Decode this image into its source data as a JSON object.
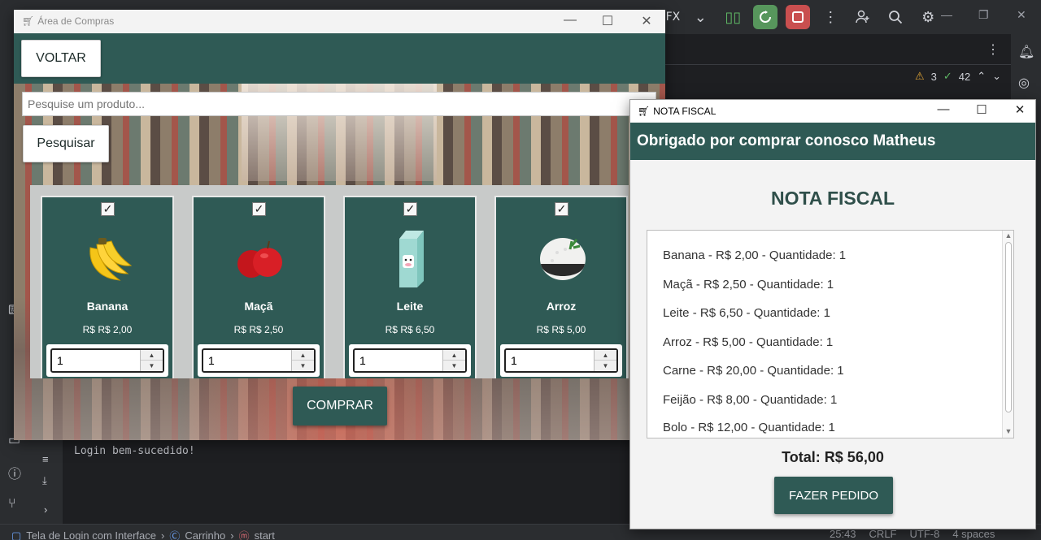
{
  "ide": {
    "run_config_label": "aFX",
    "inspections_warnings": "3",
    "inspections_ok": "42",
    "console_output": "Login bem-sucedido!",
    "status": {
      "crumb_1": "Tela de Login com Interface",
      "crumb_2": "Carrinho",
      "crumb_3": "start",
      "position": "25:43",
      "line_ending": "CRLF",
      "encoding": "UTF-8",
      "indent": "4 spaces"
    }
  },
  "shop_window": {
    "title": "Área de Compras",
    "back_label": "VOLTAR",
    "search": {
      "placeholder": "Pesquise um produto...",
      "button": "Pesquisar"
    },
    "products": [
      {
        "name": "Banana",
        "price": "R$ R$ 2,00",
        "quantity": "1",
        "checked": "✓",
        "icon": "banana-icon"
      },
      {
        "name": "Maçã",
        "price": "R$ R$ 2,50",
        "quantity": "1",
        "checked": "✓",
        "icon": "apple-icon"
      },
      {
        "name": "Leite",
        "price": "R$ R$ 6,50",
        "quantity": "1",
        "checked": "✓",
        "icon": "milk-carton-icon"
      },
      {
        "name": "Arroz",
        "price": "R$ R$ 5,00",
        "quantity": "1",
        "checked": "✓",
        "icon": "rice-bowl-icon"
      }
    ],
    "buy_label": "COMPRAR"
  },
  "invoice_window": {
    "title": "NOTA FISCAL",
    "greeting": "Obrigado por comprar conosco Matheus",
    "heading": "NOTA FISCAL",
    "items": [
      "Banana - R$ 2,00 - Quantidade: 1",
      "Maçã - R$ 2,50 - Quantidade: 1",
      "Leite - R$ 6,50 - Quantidade: 1",
      "Arroz - R$ 5,00 - Quantidade: 1",
      "Carne - R$ 20,00 - Quantidade: 1",
      "Feijão - R$ 8,00 - Quantidade: 1",
      "Bolo - R$ 12,00 - Quantidade: 1"
    ],
    "total": "Total: R$ 56,00",
    "order_label": "FAZER PEDIDO"
  },
  "colors": {
    "brand_teal": "#2f5a55",
    "run_green": "#57965c",
    "stop_red": "#c94f4f"
  }
}
